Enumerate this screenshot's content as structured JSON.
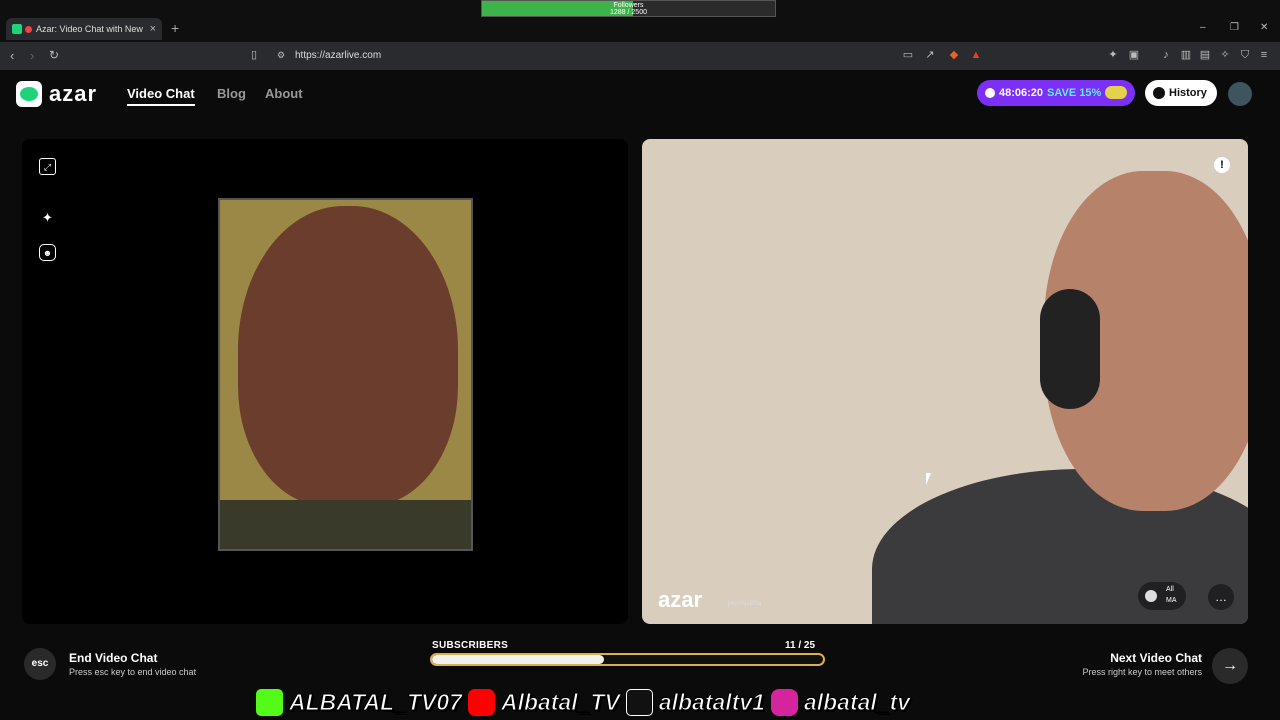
{
  "browser": {
    "tab_title": "Azar: Video Chat with New Pe",
    "tab_close": "×",
    "new_tab": "+",
    "url": "https://azarlive.com",
    "window_controls": [
      "–",
      "❐",
      "✕"
    ]
  },
  "stream_overlay": {
    "followers_label": "Followers",
    "followers_value": "1288 / 2500",
    "followers_progress": 0.515,
    "subscribers_label": "SUBSCRIBERS",
    "subscribers_value": "11  / 25",
    "subscribers_progress": 0.44,
    "social": [
      {
        "icon": "kick-icon",
        "handle": "ALBATAL_TV07"
      },
      {
        "icon": "youtube-icon",
        "handle": "Albatal_TV"
      },
      {
        "icon": "tiktok-icon",
        "handle": "albataltv1"
      },
      {
        "icon": "instagram-icon",
        "handle": "albatal_tv"
      }
    ]
  },
  "site": {
    "logo": "azar",
    "nav": [
      "Video Chat",
      "Blog",
      "About"
    ],
    "promo": {
      "timer": "48:06:20",
      "label": "SAVE 15%"
    },
    "history_label": "History",
    "accent": "#7b2ff7"
  },
  "remote_video": {
    "watermark": "azar",
    "watermark_id": "jmpYAj1BSa",
    "filter_all": "All",
    "filter_country": "MA"
  },
  "footer": {
    "esc_key": "esc",
    "end_title": "End Video Chat",
    "end_sub": "Press esc key to end video chat",
    "next_title": "Next Video Chat",
    "next_sub": "Press right key to meet others",
    "next_arrow": "→"
  }
}
